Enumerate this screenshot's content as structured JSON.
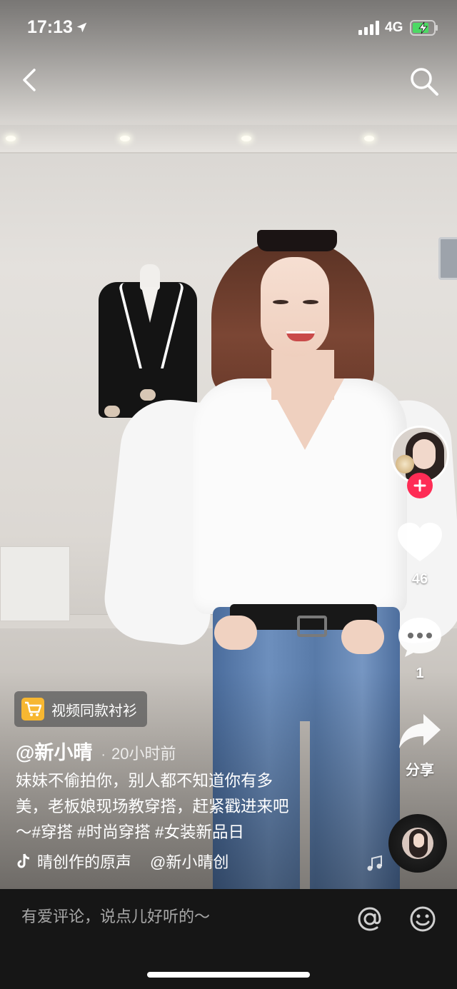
{
  "status_bar": {
    "time": "17:13",
    "network": "4G",
    "icons": [
      "location-arrow-icon",
      "signal-bars-icon",
      "battery-charging-icon"
    ]
  },
  "nav": {
    "icons": [
      "back-chevron-icon",
      "search-icon"
    ]
  },
  "rail": {
    "likes": "46",
    "comments": "1",
    "share_label": "分享",
    "icons": [
      "heart-icon",
      "comment-bubble-icon",
      "share-arrow-icon",
      "plus-icon",
      "music-disc-icon"
    ]
  },
  "product": {
    "label": "视频同款衬衫",
    "icon": "shopping-cart-icon"
  },
  "post": {
    "author": "@新小晴",
    "separator": "·",
    "time_ago": "20小时前",
    "caption_lines": [
      "妹妹不偷拍你，别人都不知道你有多",
      "美，老板娘现场教穿搭，赶紧戳进来吧",
      "～#穿搭 #时尚穿搭 #女装新品日"
    ]
  },
  "music": {
    "title": "晴创作的原声",
    "author": "@新小晴创",
    "icon": "tiktok-note-icon"
  },
  "comment_bar": {
    "placeholder": "有爱评论，说点儿好听的～",
    "icons": [
      "at-sign-icon",
      "emoji-icon"
    ]
  },
  "colors": {
    "follow_red": "#fe2c55",
    "cart_yellow": "#f7b731",
    "bottom_bar": "#161616"
  }
}
